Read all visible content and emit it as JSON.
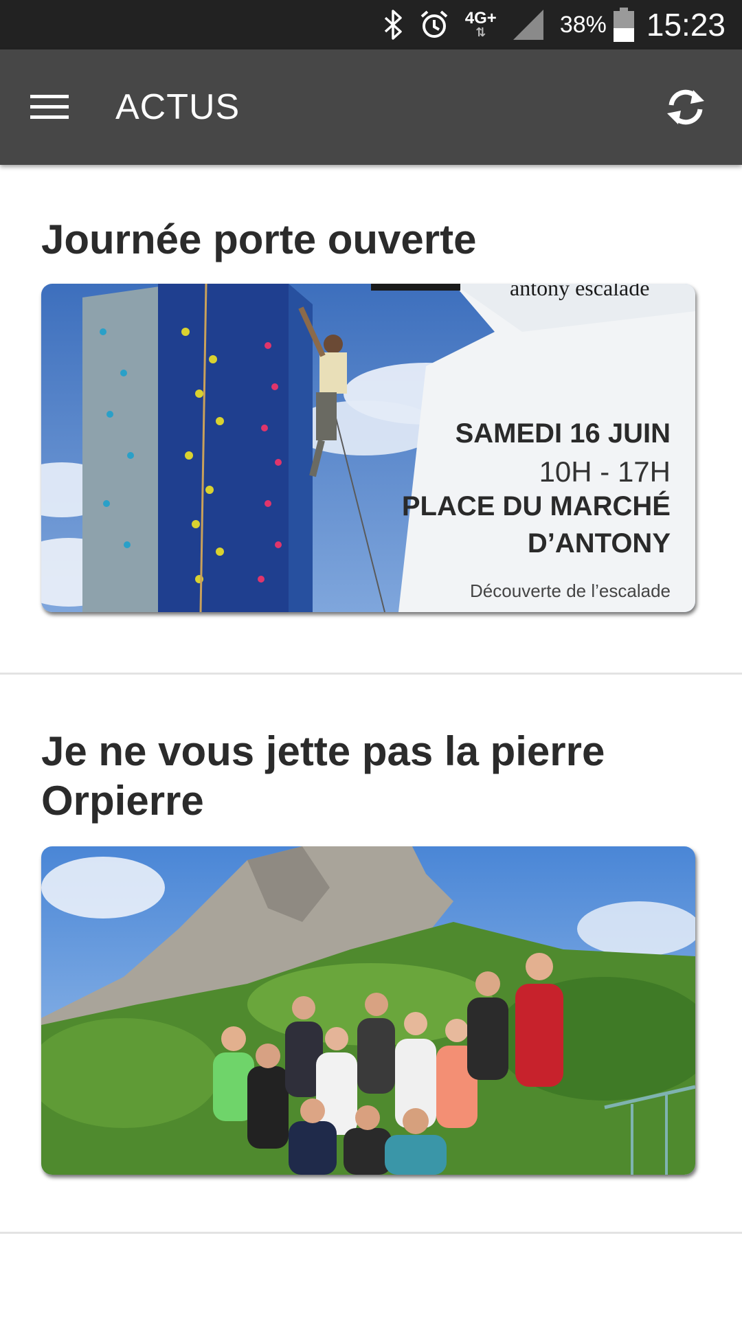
{
  "status_bar": {
    "network": "4G+",
    "battery": "38%",
    "time": "15:23",
    "icons": [
      "bluetooth-icon",
      "alarm-icon",
      "network-icon",
      "signal-icon",
      "battery-icon"
    ]
  },
  "app_bar": {
    "title": "ACTUS",
    "menu_icon": "hamburger-menu-icon",
    "refresh_icon": "refresh-icon",
    "background": "#474747"
  },
  "news": [
    {
      "title": "Journée porte ouverte",
      "image": {
        "description_icon": "climbing-wall-poster",
        "brand": "antony escalade",
        "lines": [
          "SAMEDI 16 JUIN",
          "10H - 17H",
          "PLACE DU MARCHÉ",
          "D’ANTONY",
          "Découverte de l’escalade"
        ]
      }
    },
    {
      "title": "Je ne vous jette pas la pierre Orpierre",
      "image": {
        "description_icon": "group-photo-mountain"
      }
    }
  ]
}
